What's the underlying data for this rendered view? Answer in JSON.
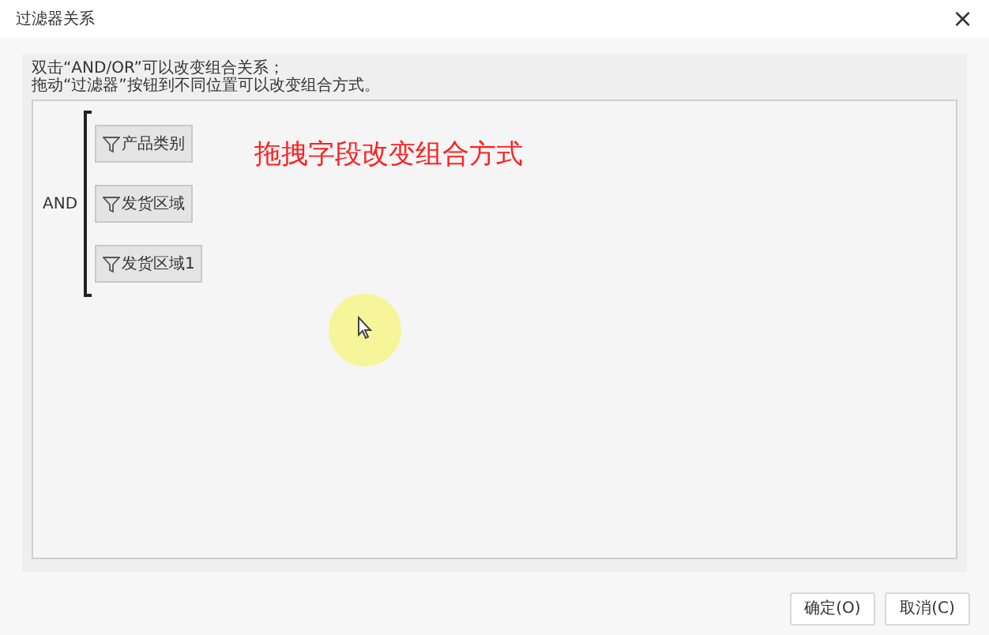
{
  "window": {
    "title": "过滤器关系",
    "close": "×"
  },
  "instructions": [
    "双击“AND/OR”可以改变组合关系；",
    "拖动“过滤器”按钮到不同位置可以改变组合方式。"
  ],
  "group": {
    "operator": "AND",
    "filters": [
      {
        "label": "产品类别"
      },
      {
        "label": "发货区域"
      },
      {
        "label": "发货区域1"
      }
    ]
  },
  "annotation": "拖拽字段改变组合方式",
  "buttons": [
    "确定(O)",
    "取消(C)"
  ]
}
